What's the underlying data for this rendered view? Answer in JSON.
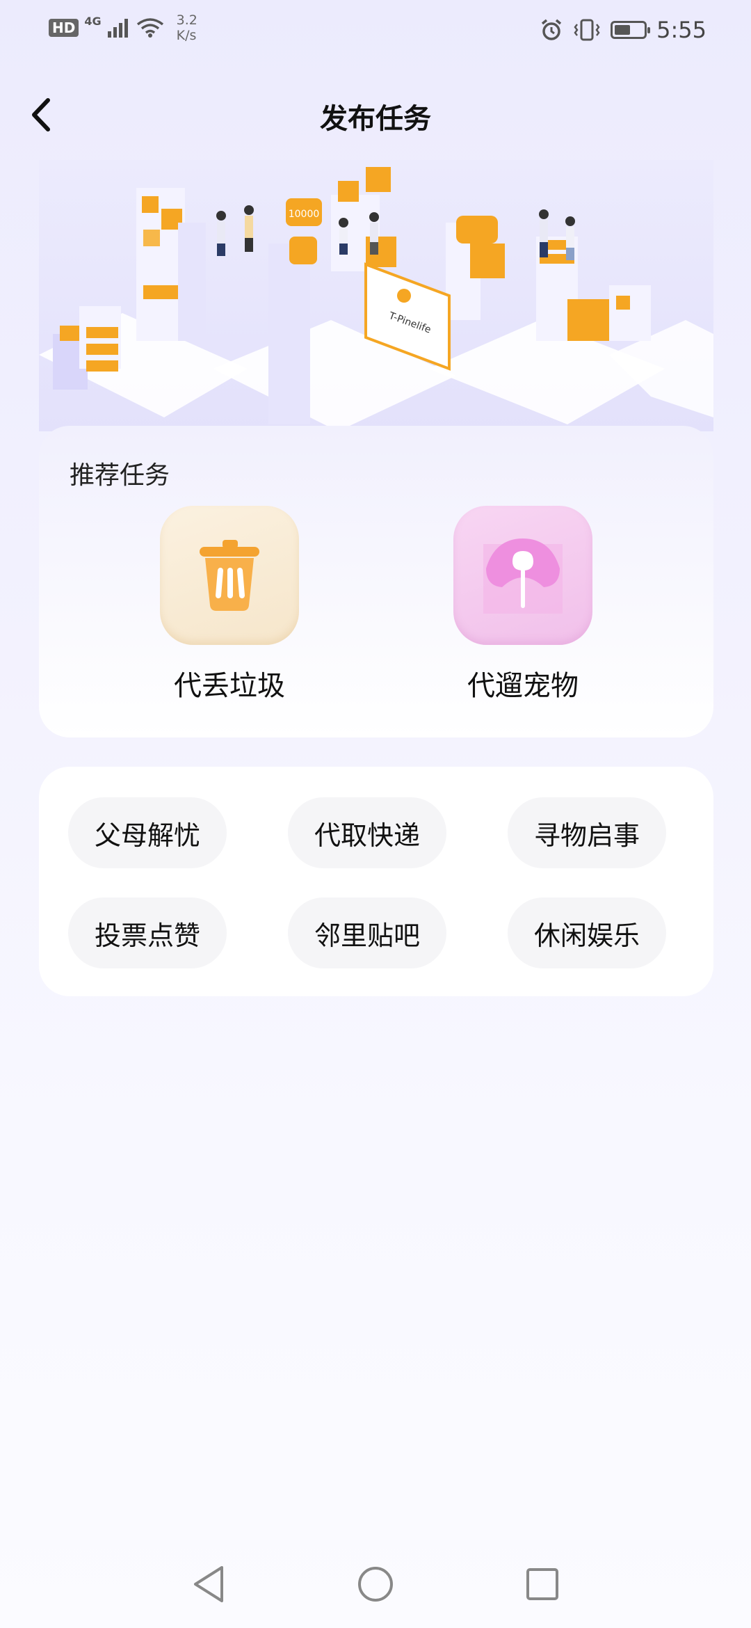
{
  "status_bar": {
    "hd": "HD",
    "network": "4G",
    "speed_value": "3.2",
    "speed_unit": "K/s",
    "battery_level": 0.6,
    "time": "5:55"
  },
  "header": {
    "title": "发布任务"
  },
  "banner": {
    "counter_text": "10000",
    "screen_text": "T-Pinelife"
  },
  "recommended": {
    "title": "推荐任务",
    "items": [
      {
        "label": "代丢垃圾",
        "icon": "trash-can-icon"
      },
      {
        "label": "代遛宠物",
        "icon": "pet-leash-icon"
      }
    ]
  },
  "categories": [
    {
      "label": "父母解忧"
    },
    {
      "label": "代取快递"
    },
    {
      "label": "寻物启事"
    },
    {
      "label": "投票点赞"
    },
    {
      "label": "邻里贴吧"
    },
    {
      "label": "休闲娱乐"
    }
  ],
  "colors": {
    "accent_orange": "#f5a623",
    "accent_pink": "#e98ad9",
    "background": "#f1f0fd"
  }
}
